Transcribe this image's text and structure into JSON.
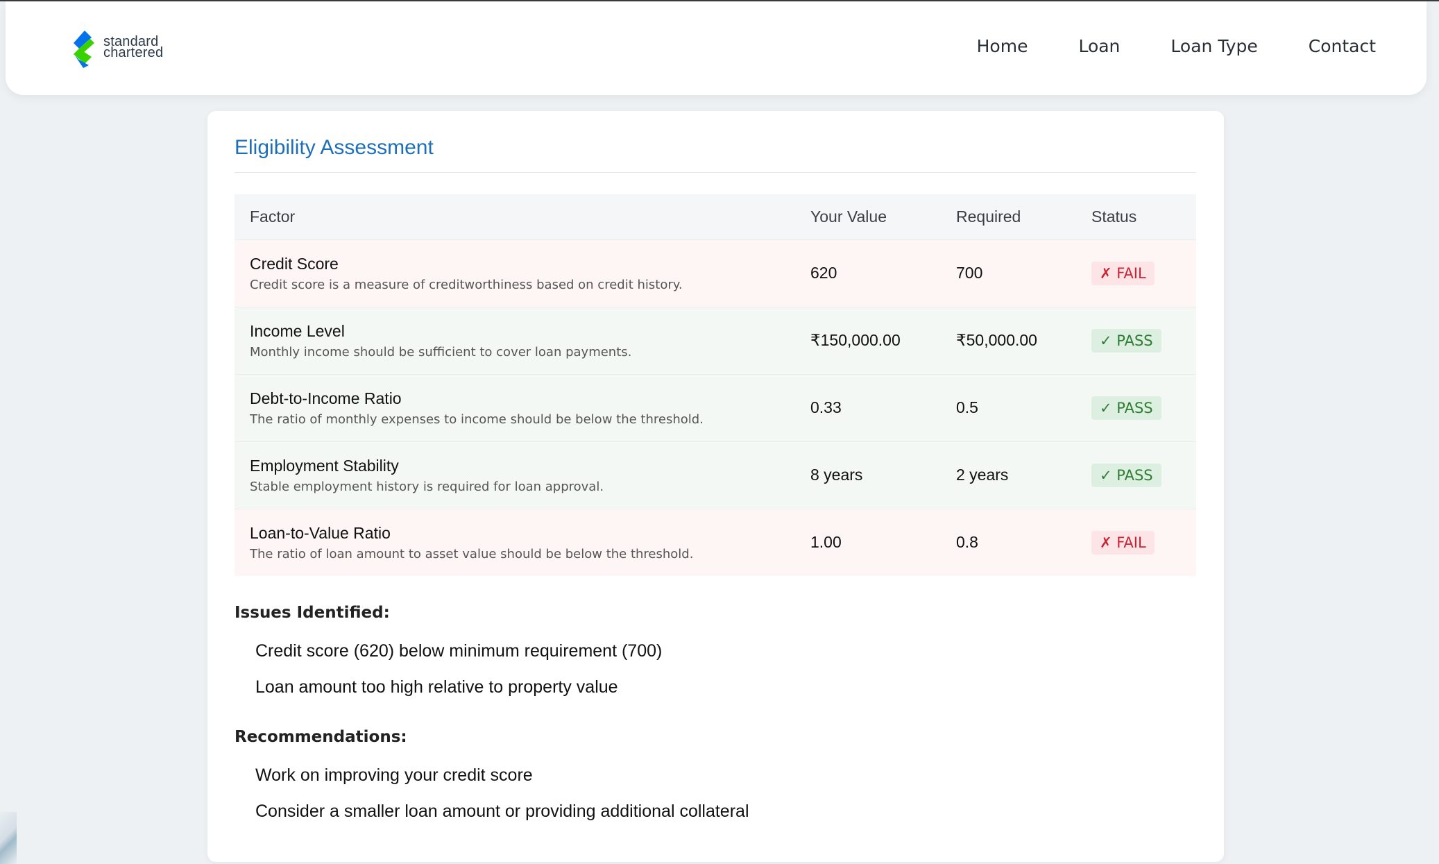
{
  "brand": {
    "line1": "standard",
    "line2": "chartered",
    "logo_colors": [
      "#0473ea",
      "#38d200"
    ]
  },
  "nav": {
    "items": [
      {
        "label": "Home"
      },
      {
        "label": "Loan"
      },
      {
        "label": "Loan Type"
      },
      {
        "label": "Contact"
      }
    ]
  },
  "assessment": {
    "title": "Eligibility Assessment",
    "columns": [
      "Factor",
      "Your Value",
      "Required",
      "Status"
    ],
    "rows": [
      {
        "factor": "Credit Score",
        "description": "Credit score is a measure of creditworthiness based on credit history.",
        "value": "620",
        "required": "700",
        "status": "✗ FAIL",
        "result": "fail"
      },
      {
        "factor": "Income Level",
        "description": "Monthly income should be sufficient to cover loan payments.",
        "value": "₹150,000.00",
        "required": "₹50,000.00",
        "status": "✓ PASS",
        "result": "pass"
      },
      {
        "factor": "Debt-to-Income Ratio",
        "description": "The ratio of monthly expenses to income should be below the threshold.",
        "value": "0.33",
        "required": "0.5",
        "status": "✓ PASS",
        "result": "pass"
      },
      {
        "factor": "Employment Stability",
        "description": "Stable employment history is required for loan approval.",
        "value": "8 years",
        "required": "2 years",
        "status": "✓ PASS",
        "result": "pass"
      },
      {
        "factor": "Loan-to-Value Ratio",
        "description": "The ratio of loan amount to asset value should be below the threshold.",
        "value": "1.00",
        "required": "0.8",
        "status": "✗ FAIL",
        "result": "fail"
      }
    ]
  },
  "issues": {
    "heading": "Issues Identified:",
    "items": [
      "Credit score (620) below minimum requirement (700)",
      "Loan amount too high relative to property value"
    ]
  },
  "recommendations": {
    "heading": "Recommendations:",
    "items": [
      "Work on improving your credit score",
      "Consider a smaller loan amount or providing additional collateral"
    ]
  },
  "colors": {
    "title_blue": "#1f6fb8",
    "fail_text": "#c82333",
    "pass_text": "#2e7d32"
  }
}
